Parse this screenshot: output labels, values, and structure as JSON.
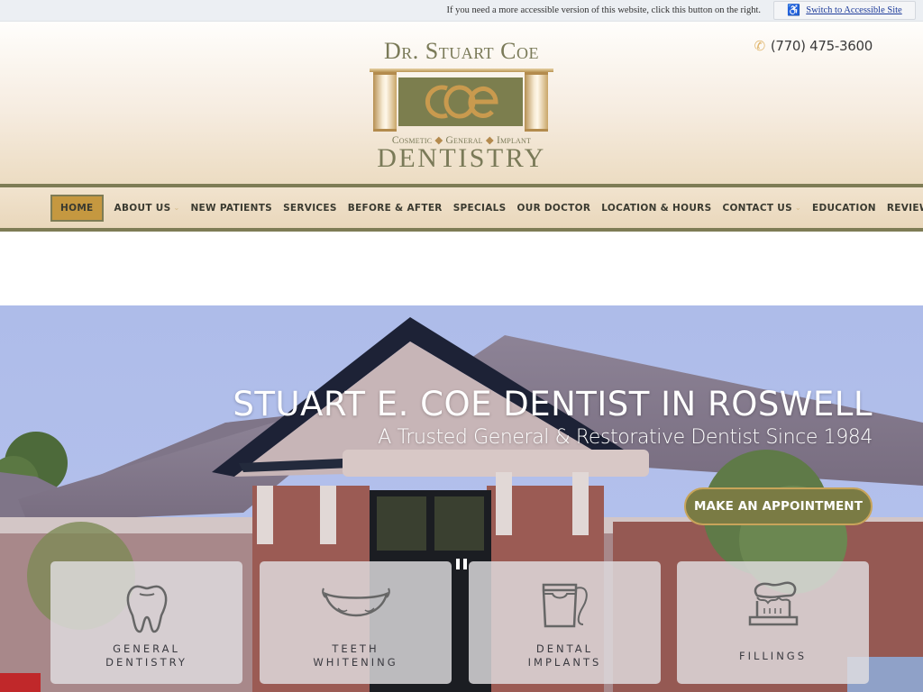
{
  "accessibility": {
    "notice": "If you need a more accessible version of this website, click this button on the right.",
    "button_label": "Switch to Accessible Site",
    "button_icon": "wheelchair-icon"
  },
  "header": {
    "logo": {
      "top_text": "Dr. Stuart Coe",
      "monogram": "COE",
      "sub_items": [
        "Cosmetic",
        "General",
        "Implant"
      ],
      "separator": "◆",
      "main_text": "DENTISTRY"
    },
    "phone": {
      "icon": "phone-icon",
      "number": "(770) 475-3600"
    }
  },
  "nav": {
    "items": [
      {
        "label": "HOME",
        "active": true,
        "dropdown": false
      },
      {
        "label": "ABOUT US",
        "active": false,
        "dropdown": true
      },
      {
        "label": "NEW PATIENTS",
        "active": false,
        "dropdown": false
      },
      {
        "label": "SERVICES",
        "active": false,
        "dropdown": false
      },
      {
        "label": "BEFORE & AFTER",
        "active": false,
        "dropdown": false
      },
      {
        "label": "SPECIALS",
        "active": false,
        "dropdown": false
      },
      {
        "label": "OUR DOCTOR",
        "active": false,
        "dropdown": false
      },
      {
        "label": "LOCATION & HOURS",
        "active": false,
        "dropdown": false
      },
      {
        "label": "CONTACT US",
        "active": false,
        "dropdown": true
      },
      {
        "label": "EDUCATION",
        "active": false,
        "dropdown": false
      },
      {
        "label": "REVIEW US",
        "active": false,
        "dropdown": false
      }
    ]
  },
  "hero": {
    "title": "STUART E. COE DENTIST IN ROSWELL",
    "subtitle": "A Trusted General & Restorative Dentist Since 1984",
    "cta_label": "MAKE AN APPOINTMENT",
    "slider_control": "pause-icon",
    "services": [
      {
        "line1": "GENERAL",
        "line2": "DENTISTRY",
        "icon": "tooth-icon"
      },
      {
        "line1": "TEETH",
        "line2": "WHITENING",
        "icon": "smile-icon"
      },
      {
        "line1": "DENTAL",
        "line2": "IMPLANTS",
        "icon": "floss-icon"
      },
      {
        "line1": "FILLINGS",
        "line2": "",
        "icon": "toothbrush-icon"
      }
    ]
  },
  "colors": {
    "olive": "#7e7c55",
    "gold": "#c59840",
    "cta_bg": "#7a7b44",
    "nav_text": "#3a3a30"
  }
}
